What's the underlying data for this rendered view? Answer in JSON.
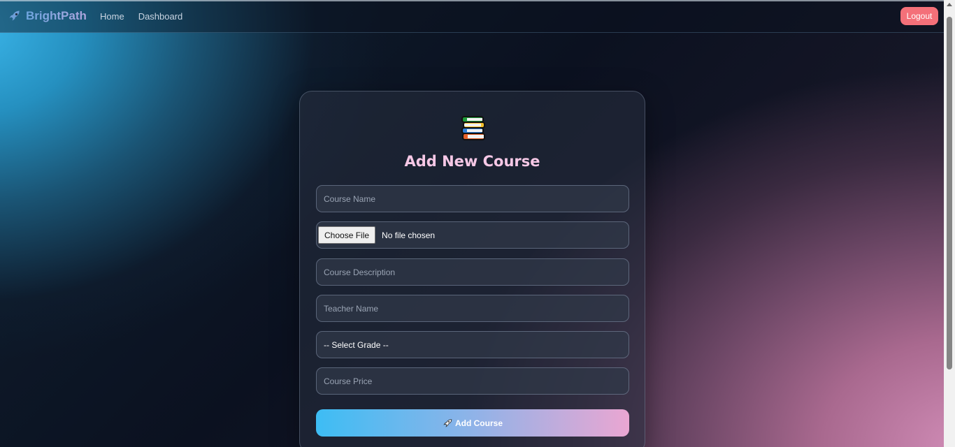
{
  "navbar": {
    "brand": "BrightPath",
    "brand_icon": "rocket-icon",
    "links": [
      {
        "label": "Home"
      },
      {
        "label": "Dashboard"
      }
    ],
    "logout_label": "Logout"
  },
  "form": {
    "icon": "books-icon",
    "title": "Add New Course",
    "course_name_placeholder": "Course Name",
    "file_button_label": "Choose File",
    "file_status": "No file chosen",
    "description_placeholder": "Course Description",
    "teacher_placeholder": "Teacher Name",
    "grade_selected": "-- Select Grade --",
    "price_placeholder": "Course Price",
    "submit_label": "Add Course",
    "submit_icon": "rocket-icon"
  },
  "colors": {
    "accent_pink": "#f6c8e6",
    "logout_red": "#f47079",
    "button_gradient_start": "#3dbdf4",
    "button_gradient_end": "#eaa6d2"
  }
}
